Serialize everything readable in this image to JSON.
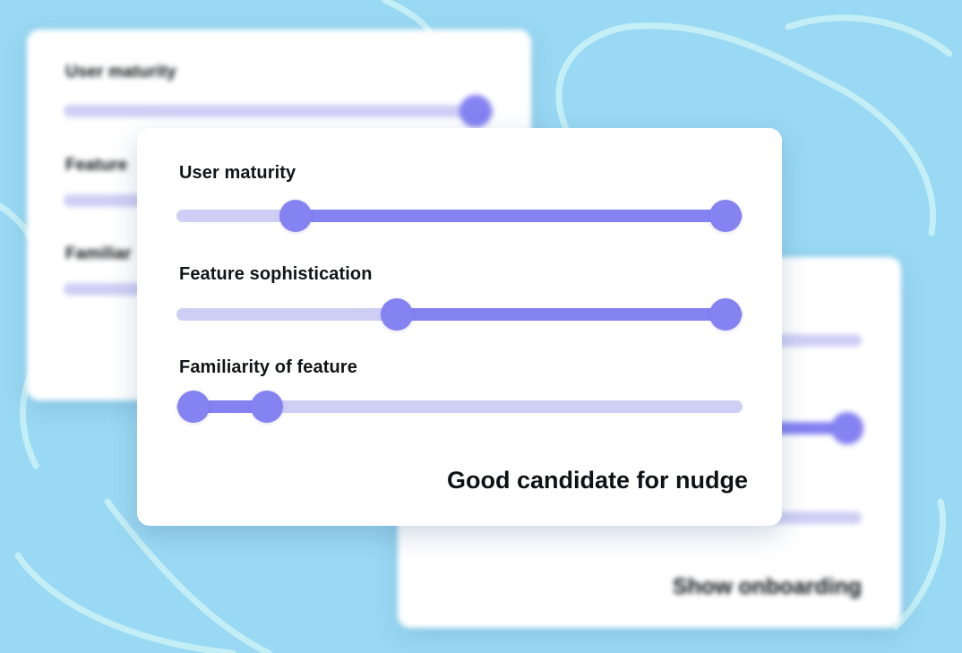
{
  "colors": {
    "background": "#9ad9f3",
    "accent": "#8582f2",
    "track": "#cfcff5",
    "card": "#ffffff"
  },
  "back_left_card": {
    "labels": [
      "User maturity",
      "Feature",
      "Familiar"
    ],
    "sliders": [
      {
        "low": 0.0,
        "high": 1.0
      },
      {
        "low": 0.0,
        "high": 0.0
      },
      {
        "low": 0.0,
        "high": 0.0
      }
    ]
  },
  "front_card": {
    "sliders": [
      {
        "label": "User maturity",
        "low": 0.21,
        "high": 0.97
      },
      {
        "label": "Feature sophistication",
        "low": 0.39,
        "high": 0.97
      },
      {
        "label": "Familiarity of feature",
        "low": 0.03,
        "high": 0.16
      }
    ],
    "result": "Good candidate for nudge"
  },
  "back_right_card": {
    "result": "Show onboarding"
  }
}
